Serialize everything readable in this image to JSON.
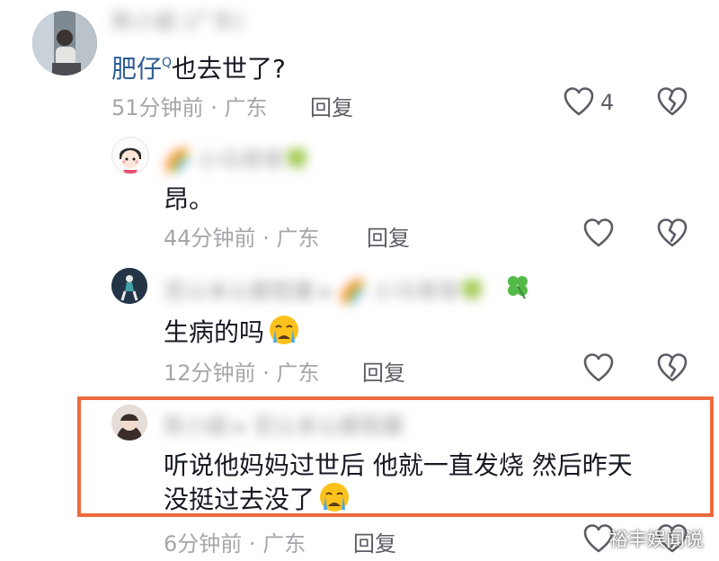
{
  "comments": [
    {
      "username": "陈小姐 (广东)",
      "text_name": "肥仔",
      "text_rest": "也去世了?",
      "time": "51分钟前",
      "location": "广东",
      "reply_label": "回复",
      "like_count": "4"
    },
    {
      "username": "🌈 小马哥哥🍀",
      "text": "昂。",
      "time": "44分钟前",
      "location": "广东",
      "reply_label": "回复"
    },
    {
      "username": "否认本认都阻塞 ▸ 🌈 小马哥哥🍀",
      "text": "生病的吗",
      "time": "12分钟前",
      "location": "广东",
      "reply_label": "回复"
    },
    {
      "username": "陈小姐 ▸ 否认本认都阻塞",
      "text_line1": "听说他妈妈过世后 他就一直发烧 然后昨天",
      "text_line2": "没挺过去没了",
      "time": "6分钟前",
      "location": "广东",
      "reply_label": "回复"
    }
  ],
  "separator": "·",
  "watermark": "裕丰娱闻说",
  "colors": {
    "highlight_border": "#ee6a3c",
    "link_name": "#2e5d95",
    "meta_text": "#a6a6ab"
  },
  "icons": [
    "heart-outline-icon",
    "broken-heart-outline-icon",
    "crying-face-emoji",
    "clover-emoji",
    "rainbow-emoji"
  ]
}
